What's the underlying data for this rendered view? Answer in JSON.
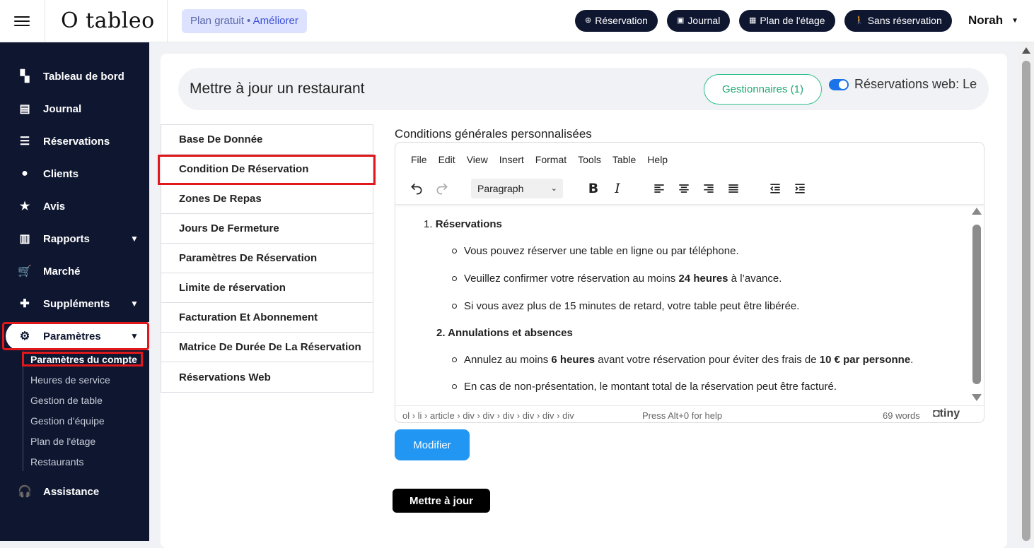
{
  "brand": {
    "logo_text": "O tableo"
  },
  "plan": {
    "label": "Plan gratuit •",
    "upgrade": "Améliorer"
  },
  "top_buttons": [
    {
      "label": "Réservation",
      "icon": "plus-circle-icon"
    },
    {
      "label": "Journal",
      "icon": "journal-icon"
    },
    {
      "label": "Plan de l'étage",
      "icon": "calendar-icon"
    },
    {
      "label": "Sans réservation",
      "icon": "walk-in-icon"
    }
  ],
  "user": {
    "name": "Norah"
  },
  "sidebar": {
    "items": [
      {
        "label": "Tableau de bord",
        "icon": "dashboard-icon"
      },
      {
        "label": "Journal",
        "icon": "book-icon"
      },
      {
        "label": "Réservations",
        "icon": "list-icon"
      },
      {
        "label": "Clients",
        "icon": "user-icon"
      },
      {
        "label": "Avis",
        "icon": "star-icon"
      },
      {
        "label": "Rapports",
        "icon": "chart-icon"
      },
      {
        "label": "Marché",
        "icon": "cart-icon"
      },
      {
        "label": "Suppléments",
        "icon": "puzzle-icon"
      },
      {
        "label": "Paramètres",
        "icon": "gear-icon"
      },
      {
        "label": "Assistance",
        "icon": "headset-icon"
      }
    ],
    "sub_items": [
      "Paramètres du compte",
      "Heures de service",
      "Gestion de table",
      "Gestion d'équipe",
      "Plan de l'étage",
      "Restaurants"
    ]
  },
  "header": {
    "title": "Mettre à jour un restaurant",
    "managers_button": "Gestionnaires (1)",
    "web_reservations_label": "Réservations web: Le"
  },
  "settings_menu": [
    "Base De Donnée",
    "Condition De Réservation",
    "Zones De Repas",
    "Jours De Fermeture",
    "Paramètres De Réservation",
    "Limite de réservation",
    "Facturation Et Abonnement",
    "Matrice De Durée De La Réservation",
    "Réservations Web"
  ],
  "editor": {
    "title": "Conditions générales personnalisées",
    "menubar": [
      "File",
      "Edit",
      "View",
      "Insert",
      "Format",
      "Tools",
      "Table",
      "Help"
    ],
    "block_format": "Paragraph",
    "content": {
      "s1_num": "1.",
      "s1_title": "Réservations",
      "s1_b1": "Vous pouvez réserver une table en ligne ou par téléphone.",
      "s1_b2_pre": "Veuillez confirmer votre réservation au moins ",
      "s1_b2_bold": "24 heures",
      "s1_b2_post": " à l’avance.",
      "s1_b3": "Si vous avez plus de 15 minutes de retard, votre table peut être libérée.",
      "s2_title": "2. Annulations et absences",
      "s2_b1_pre": "Annulez au moins ",
      "s2_b1_bold1": "6 heures",
      "s2_b1_mid": " avant votre réservation pour éviter des frais de ",
      "s2_b1_bold2": "10 € par personne",
      "s2_b1_post": ".",
      "s2_b2": "En cas de non-présentation, le montant total de la réservation peut être facturé."
    },
    "status_path": "ol › li › article › div › div › div › div › div › div",
    "status_help": "Press Alt+0 for help",
    "word_count": "69 words",
    "brand": "tiny"
  },
  "buttons": {
    "modify": "Modifier",
    "update": "Mettre à jour"
  },
  "colors": {
    "navy": "#0e1630",
    "accent_blue": "#2196f3",
    "highlight_red": "#e0181b",
    "green": "#2dc28a"
  }
}
